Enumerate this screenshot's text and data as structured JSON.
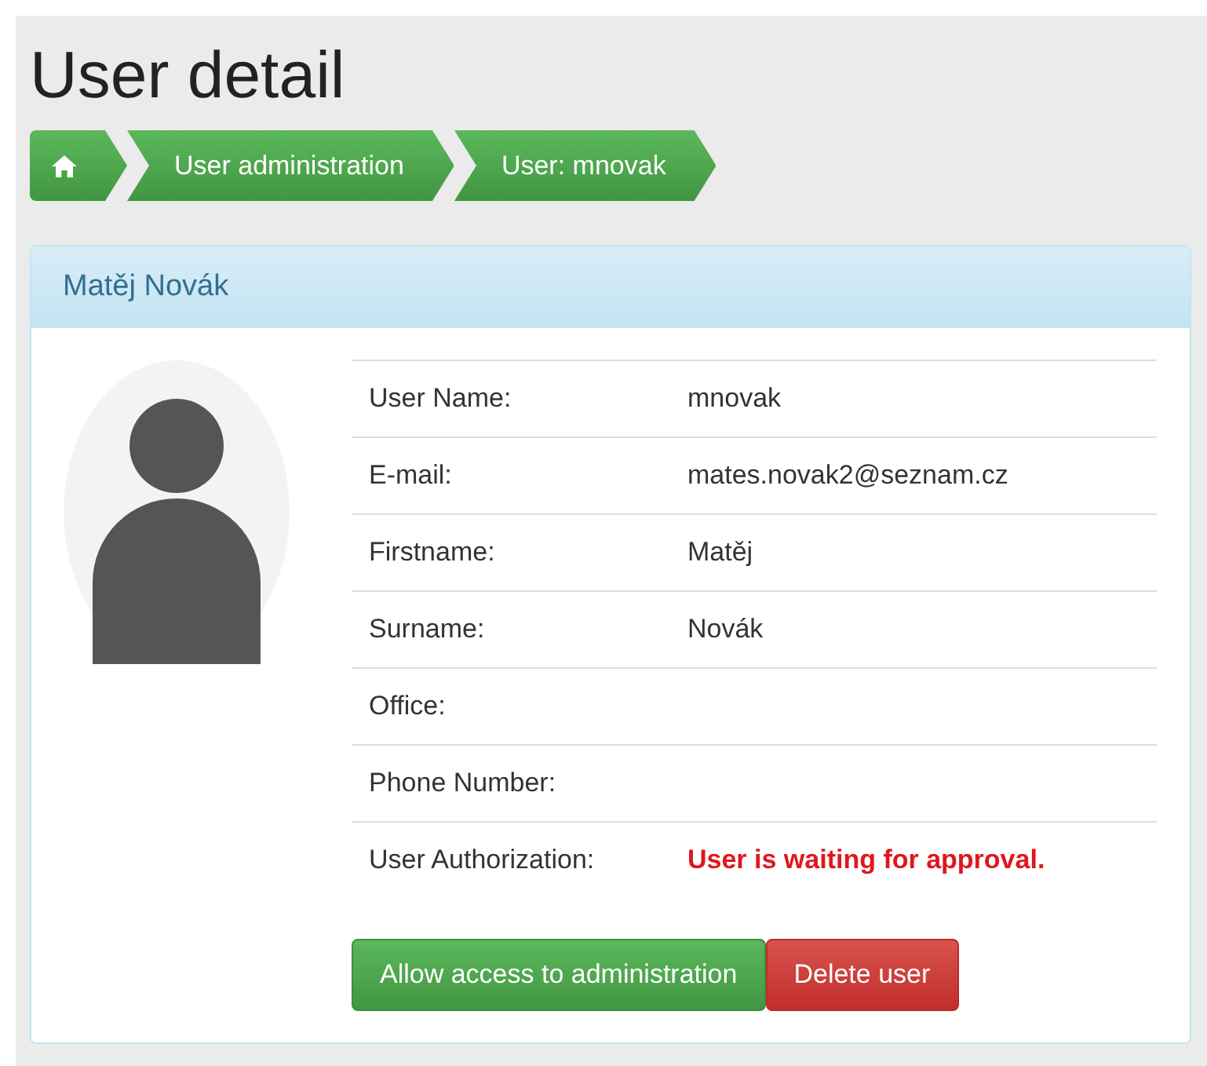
{
  "title": "User detail",
  "breadcrumb": [
    {
      "kind": "home"
    },
    {
      "kind": "text",
      "label": "User administration"
    },
    {
      "kind": "text",
      "label": "User: mnovak"
    }
  ],
  "card": {
    "title": "Matěj Novák",
    "fields": [
      {
        "label": "User Name:",
        "value": "mnovak",
        "kind": "plain"
      },
      {
        "label": "E-mail:",
        "value": "mates.novak2@seznam.cz",
        "kind": "plain"
      },
      {
        "label": "Firstname:",
        "value": "Matěj",
        "kind": "plain"
      },
      {
        "label": "Surname:",
        "value": "Novák",
        "kind": "plain"
      },
      {
        "label": "Office:"
      },
      {
        "label": "Phone Number:"
      },
      {
        "label": "User Authorization:",
        "value": "User is waiting for approval.",
        "kind": "warning"
      }
    ],
    "buttons": [
      {
        "label": "Allow access to administration",
        "kind": "success"
      },
      {
        "label": "Delete user",
        "kind": "danger"
      }
    ]
  }
}
